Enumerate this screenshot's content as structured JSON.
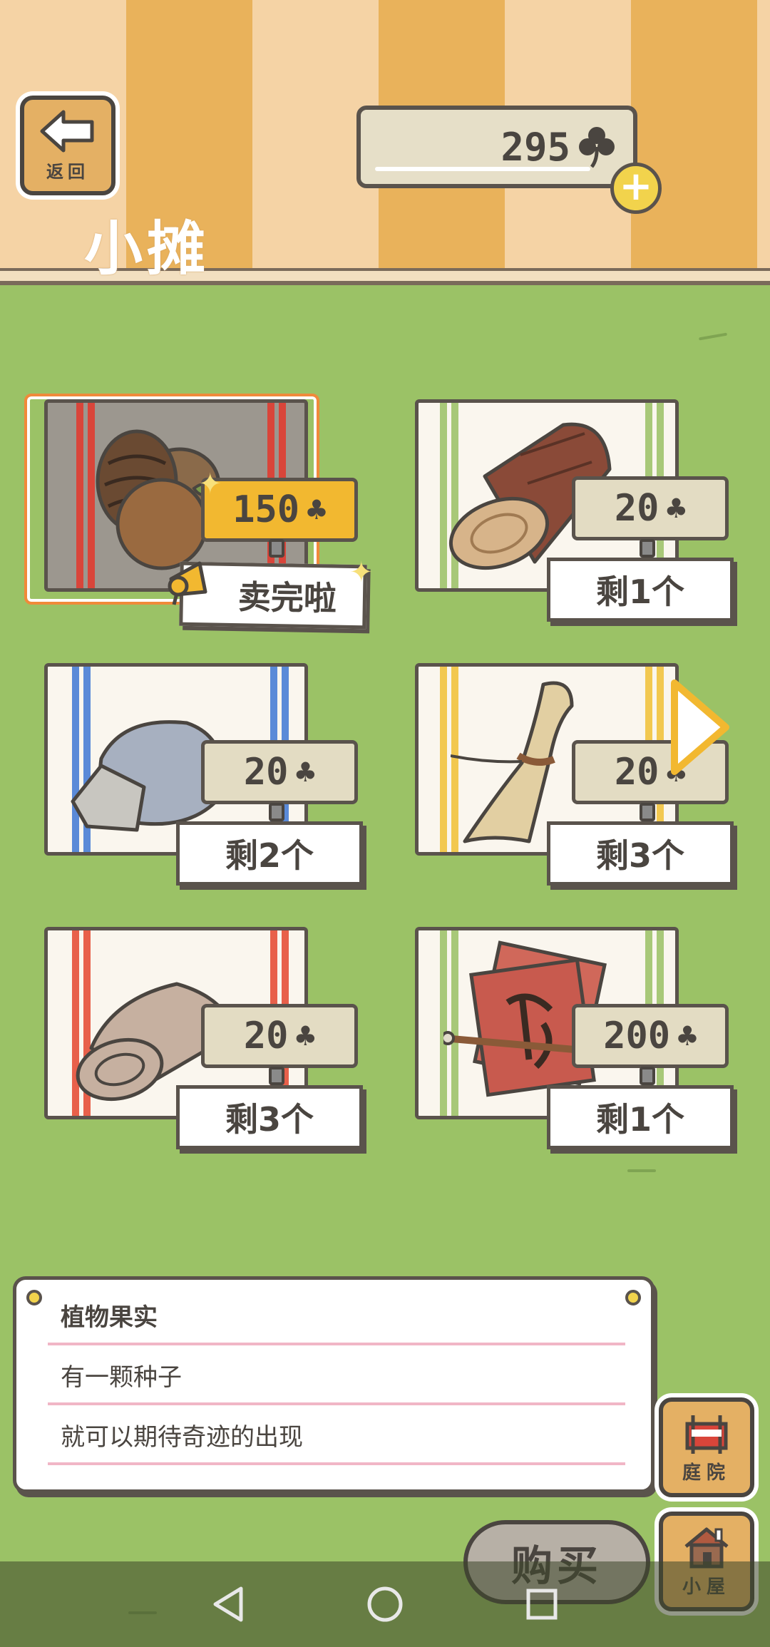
{
  "header": {
    "back_label": "返回",
    "title": "小摊",
    "currency_value": "295",
    "currency_icon": "clover-icon",
    "add_icon": "plus-icon"
  },
  "items": [
    {
      "name": "pinecone-and-fruit",
      "price": "150",
      "stock": "卖完啦",
      "selected": true
    },
    {
      "name": "log",
      "price": "20",
      "stock": "剩1个"
    },
    {
      "name": "stone",
      "price": "20",
      "stock": "剩2个"
    },
    {
      "name": "straw-bundle",
      "price": "20",
      "stock": "剩3个"
    },
    {
      "name": "cloth-roll",
      "price": "20",
      "stock": "剩3个"
    },
    {
      "name": "calligraphy-paper-and-brush",
      "price": "200",
      "stock": "剩1个"
    }
  ],
  "description": {
    "title": "植物果实",
    "line1": "有一颗种子",
    "line2": "就可以期待奇迹的出现"
  },
  "side_buttons": {
    "yard_label": "庭院",
    "house_label": "小屋"
  },
  "buy_label": "购买",
  "colors": {
    "grass": "#9bc266",
    "stripe_light": "#f5d3a5",
    "stripe_dark": "#e9b25b",
    "price_hot": "#f2b830",
    "selection": "#f08a3a"
  }
}
